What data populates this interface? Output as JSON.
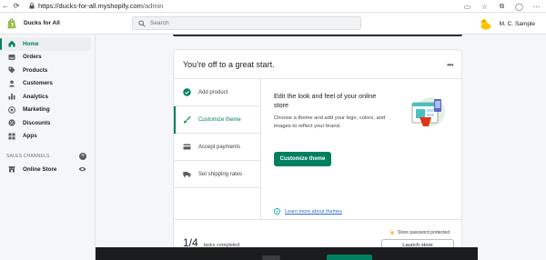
{
  "browser": {
    "url_prefix": "https://",
    "url_domain": "ducks-for-all.myshopify.com",
    "url_path": "/admin"
  },
  "header": {
    "store_name": "Ducks for All",
    "search_placeholder": "Search",
    "user_name": "M. C. Sample"
  },
  "sidebar": {
    "items": [
      {
        "label": "Home",
        "icon": "home-icon",
        "active": true
      },
      {
        "label": "Orders",
        "icon": "orders-icon"
      },
      {
        "label": "Products",
        "icon": "tag-icon"
      },
      {
        "label": "Customers",
        "icon": "person-icon"
      },
      {
        "label": "Analytics",
        "icon": "bar-chart-icon"
      },
      {
        "label": "Marketing",
        "icon": "target-icon"
      },
      {
        "label": "Discounts",
        "icon": "discount-icon"
      },
      {
        "label": "Apps",
        "icon": "apps-icon"
      }
    ],
    "sales_channels_label": "SALES CHANNELS",
    "online_store_label": "Online Store"
  },
  "card": {
    "title": "You’re off to a great start.",
    "menu": "•••",
    "steps": [
      {
        "label": "Add product",
        "icon": "check-circle-icon"
      },
      {
        "label": "Customize theme",
        "icon": "brush-icon",
        "active": true
      },
      {
        "label": "Accept payments",
        "icon": "payment-icon"
      },
      {
        "label": "Set shipping rates",
        "icon": "truck-icon"
      }
    ],
    "detail_title": "Edit the look and feel of your online store",
    "detail_desc": "Choose a theme and add your logo, colors, and images to reflect your brand.",
    "detail_button": "Customize theme",
    "learn_more": "Learn more about themes",
    "progress_count": "1/4",
    "progress_label": "tasks completed",
    "password_status": "Store password protected",
    "launch_button": "Launch store"
  },
  "colors": {
    "accent": "#008060",
    "link": "#2c6ecb",
    "status_warning": "#ffc453"
  }
}
